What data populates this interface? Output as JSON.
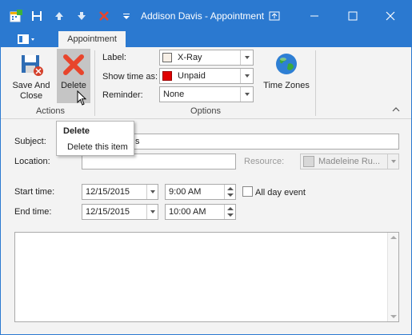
{
  "window": {
    "title": "Addison Davis - Appointment"
  },
  "quick_access": {
    "icons": [
      "app-calendar-icon",
      "save-icon",
      "arrow-up-icon",
      "arrow-down-icon",
      "delete-icon",
      "customize-dropdown-icon"
    ]
  },
  "window_controls": {
    "icons": [
      "restore-icon",
      "minimize-icon",
      "maximize-icon",
      "close-icon"
    ]
  },
  "tabs": {
    "active_label": "Appointment"
  },
  "ribbon": {
    "actions": {
      "group_label": "Actions",
      "save_close_line1": "Save And",
      "save_close_line2": "Close",
      "delete_label": "Delete"
    },
    "options": {
      "group_label": "Options",
      "label_caption": "Label:",
      "label_value": "X-Ray",
      "label_color": "#f7efe6",
      "show_time_caption": "Show time as:",
      "show_time_value": "Unpaid",
      "show_time_color": "#e00000",
      "reminder_caption": "Reminder:",
      "reminder_value": "None"
    },
    "time_zones_label": "Time Zones"
  },
  "tooltip": {
    "title": "Delete",
    "description": "Delete this item"
  },
  "form": {
    "subject_label": "Subject:",
    "subject_value": "s",
    "location_label": "Location:",
    "location_value": "",
    "resource_label": "Resource:",
    "resource_value": "Madeleine Ru...",
    "start_label": "Start time:",
    "start_date": "12/15/2015",
    "start_time": "9:00 AM",
    "all_day_label": "All day event",
    "end_label": "End time:",
    "end_date": "12/15/2015",
    "end_time": "10:00 AM",
    "notes": ""
  },
  "colors": {
    "titlebar": "#2b79d0",
    "background": "#f3f3f3"
  }
}
